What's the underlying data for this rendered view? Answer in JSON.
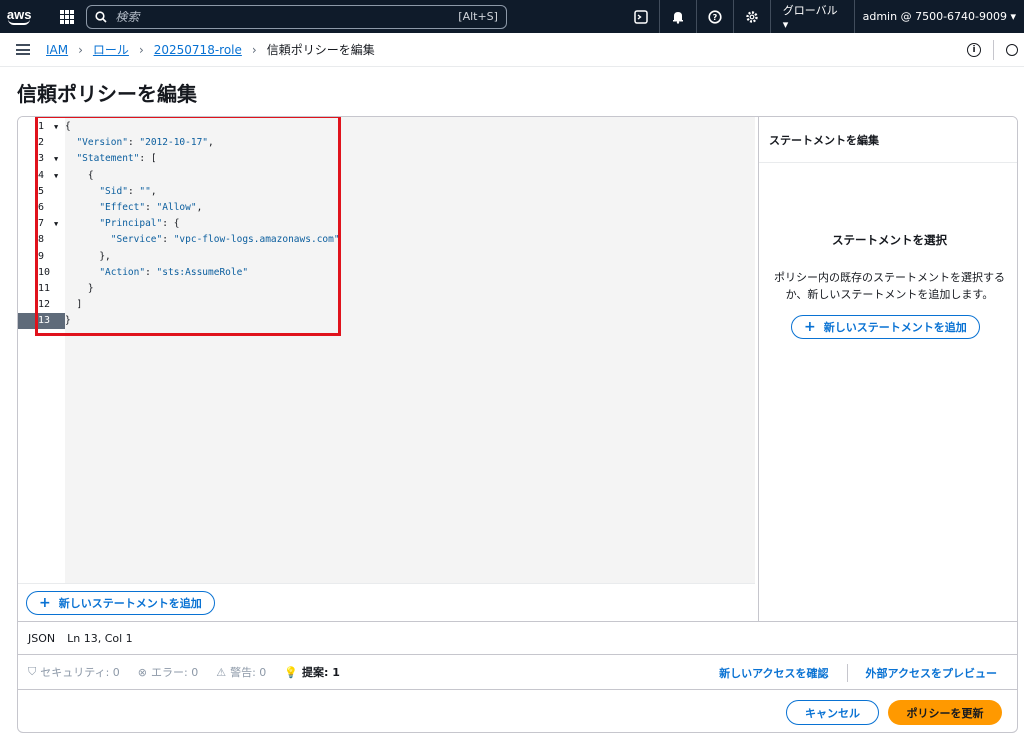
{
  "topnav": {
    "logo": "aws",
    "search_placeholder": "検索",
    "search_shortcut": "[Alt+S]",
    "icons": [
      "cloudshell-icon",
      "bell-icon",
      "help-icon",
      "settings-icon"
    ],
    "region": "グローバル ▾",
    "account": "admin @ 7500-6740-9009 ▾"
  },
  "breadcrumb": {
    "items": [
      "IAM",
      "ロール",
      "20250718-role"
    ],
    "current": "信頼ポリシーを編集"
  },
  "page": {
    "title": "信頼ポリシーを編集"
  },
  "editor": {
    "lines": [
      {
        "n": "1",
        "fold": true
      },
      {
        "n": "2"
      },
      {
        "n": "3",
        "fold": true
      },
      {
        "n": "4",
        "fold": true
      },
      {
        "n": "5",
        "bulb": true
      },
      {
        "n": "6"
      },
      {
        "n": "7",
        "fold": true
      },
      {
        "n": "8"
      },
      {
        "n": "9"
      },
      {
        "n": "10"
      },
      {
        "n": "11"
      },
      {
        "n": "12"
      },
      {
        "n": "13",
        "active": true
      }
    ],
    "code": {
      "l1": "{",
      "l2_key": "\"Version\"",
      "l2_val": "\"2012-10-17\"",
      "l3_key": "\"Statement\"",
      "l4": "{",
      "l5_key": "\"Sid\"",
      "l5_val": "\"\"",
      "l6_key": "\"Effect\"",
      "l6_val": "\"Allow\"",
      "l7_key": "\"Principal\"",
      "l8_key": "\"Service\"",
      "l8_val": "\"vpc-flow-logs.amazonaws.com\"",
      "l9": "},",
      "l10_key": "\"Action\"",
      "l10_val": "\"sts:AssumeRole\"",
      "l11": "}",
      "l12": "]",
      "l13": "}"
    },
    "add_statement_label": "新しいステートメントを追加"
  },
  "side_panel": {
    "header": "ステートメントを編集",
    "empty_title": "ステートメントを選択",
    "empty_desc": "ポリシー内の既存のステートメントを選択するか、新しいステートメントを追加します。",
    "add_button": "新しいステートメントを追加"
  },
  "status": {
    "mode": "JSON",
    "position": "Ln 13, Col 1"
  },
  "checks": {
    "security": "セキュリティ: 0",
    "errors": "エラー: 0",
    "warnings": "警告: 0",
    "suggestions": "提案: 1",
    "link_new_access": "新しいアクセスを確認",
    "link_external": "外部アクセスをプレビュー"
  },
  "actions": {
    "cancel": "キャンセル",
    "submit": "ポリシーを更新"
  },
  "colors": {
    "nav_bg": "#0f1b2a",
    "link": "#0972d3",
    "primary": "#ff9900",
    "highlight": "#e0121c"
  }
}
